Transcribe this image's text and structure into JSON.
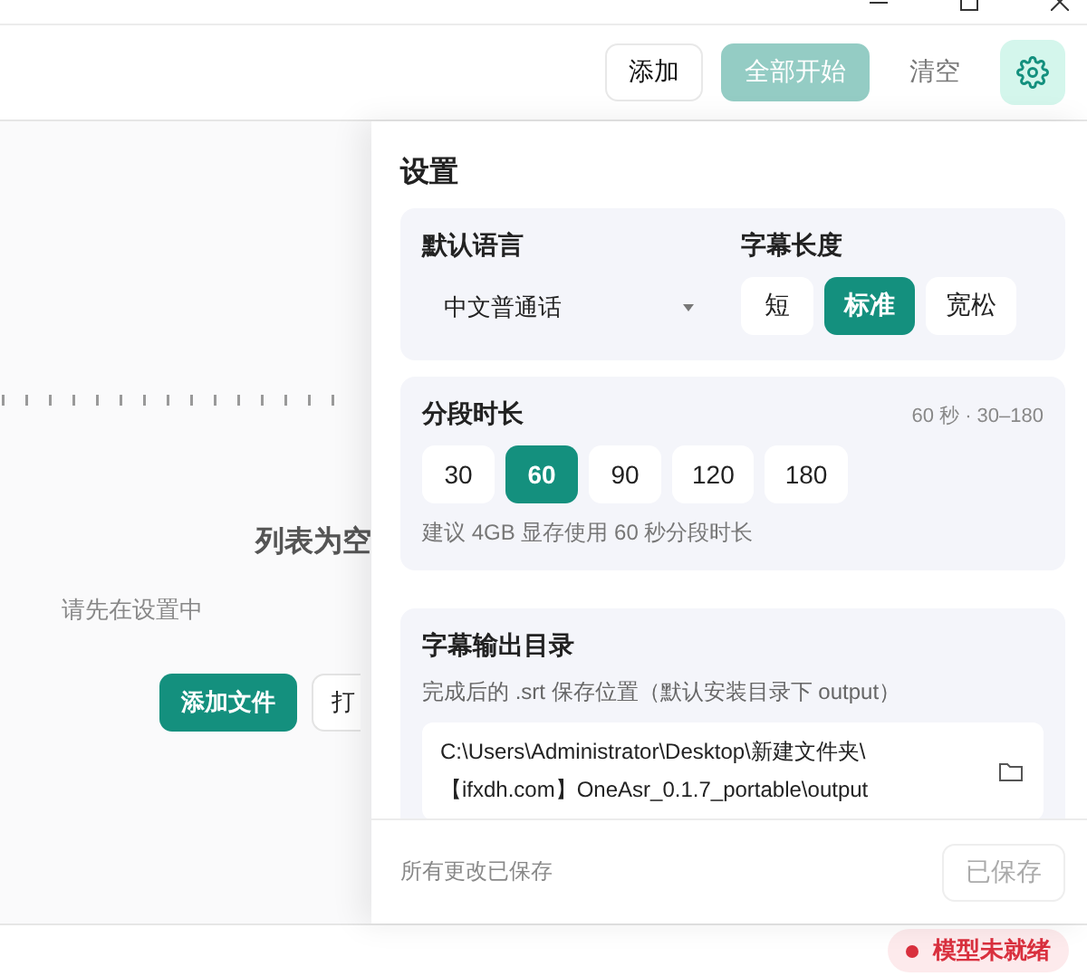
{
  "toolbar": {
    "buttons": [
      {
        "label": "添加",
        "kind": "outline",
        "disabled": false
      },
      {
        "label": "全部开始",
        "kind": "primary",
        "disabled": true
      },
      {
        "label": "清空",
        "kind": "text",
        "disabled": false
      }
    ],
    "settings_button": {
      "selected": true
    }
  },
  "list": {
    "title": "列表为空",
    "hint": "请先在设置中",
    "buttons": [
      {
        "label": "添加文件",
        "kind": "primary"
      },
      {
        "label": "打",
        "kind": "outline"
      }
    ]
  },
  "settings": {
    "title": "设置",
    "language": {
      "label": "默认语言",
      "value": "中文普通话"
    },
    "subtitle_length": {
      "label": "字幕长度",
      "options": [
        {
          "label": "短",
          "selected": false
        },
        {
          "label": "标准",
          "selected": true
        },
        {
          "label": "宽松",
          "selected": false
        }
      ]
    },
    "segment": {
      "label": "分段时长",
      "reading": "60 秒 · 30–180",
      "options": [
        {
          "label": "30",
          "selected": false
        },
        {
          "label": "60",
          "selected": true
        },
        {
          "label": "90",
          "selected": false
        },
        {
          "label": "120",
          "selected": false
        },
        {
          "label": "180",
          "selected": false
        }
      ],
      "note": "建议 4GB 显存使用 60 秒分段时长"
    },
    "output": {
      "label": "字幕输出目录",
      "description": "完成后的 .srt 保存位置（默认安装目录下 output）",
      "path": "C:\\Users\\Administrator\\Desktop\\新建文件夹\\\n【ifxdh.com】OneAsr_0.1.7_portable\\output"
    },
    "footer": {
      "status": "所有更改已保存",
      "save": {
        "label": "已保存",
        "disabled": true
      }
    }
  },
  "status_bar": {
    "model_status": {
      "label": "模型未就绪",
      "color": "#d9303e"
    }
  }
}
